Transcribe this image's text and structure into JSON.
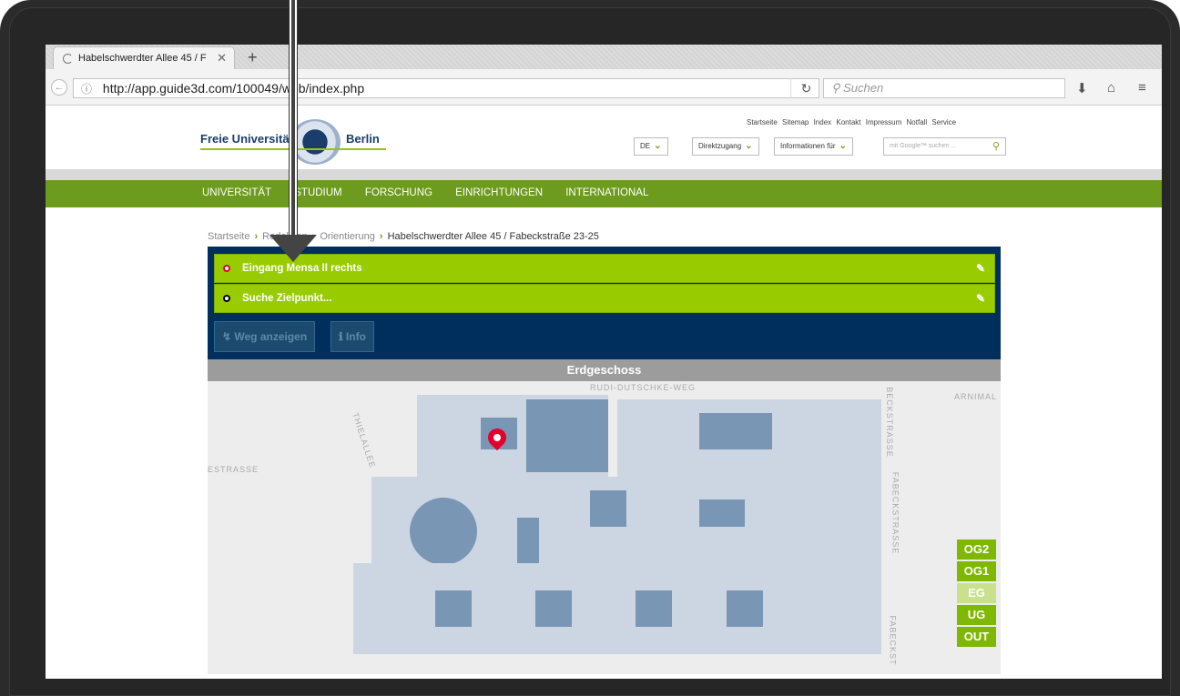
{
  "browser": {
    "tab_title": "Habelschwerdter Allee 45 / F",
    "url": "http://app.guide3d.com/100049/web/index.php",
    "search_placeholder": "Suchen"
  },
  "site": {
    "logo_left": "Freie Universität",
    "logo_right": "Berlin",
    "toplinks": "Startseite  Sitemap  Index  Kontakt  Impressum  Notfall  Service",
    "lang": "DE",
    "direktzugang": "Direktzugang",
    "informationen": "Informationen für",
    "google_placeholder": "mit Google™ suchen ...",
    "nav": [
      "UNIVERSITÄT",
      "STUDIUM",
      "FORSCHUNG",
      "EINRICHTUNGEN",
      "INTERNATIONAL"
    ],
    "breadcrumb": [
      "Startseite",
      "Redaktion",
      "Orientierung",
      "Habelschwerdter Allee 45 / Fabeckstraße 23-25"
    ]
  },
  "app": {
    "start_field": "Eingang Mensa II rechts",
    "target_field": "Suche Zielpunkt...",
    "route_button": "Weg anzeigen",
    "info_button": "Info",
    "floor_title": "Erdgeschoss",
    "floors": [
      "OG2",
      "OG1",
      "EG",
      "UG",
      "OUT"
    ],
    "active_floor": "EG",
    "streets": {
      "rudi": "RUDI-DUTSCHKE-WEG",
      "arnim": "ARNIMAL",
      "thiel": "THIELALLEE",
      "estrasse": "ESTRASSE",
      "fabeck1": "BECKSTRASSE",
      "fabeck2": "FABECKSTRASSE",
      "fabeck3": "FABECKST"
    }
  },
  "colors": {
    "fu_green": "#6d9b1e",
    "app_blue": "#002f5d",
    "field_green": "#99cc00",
    "marker_red": "#e3002d"
  }
}
